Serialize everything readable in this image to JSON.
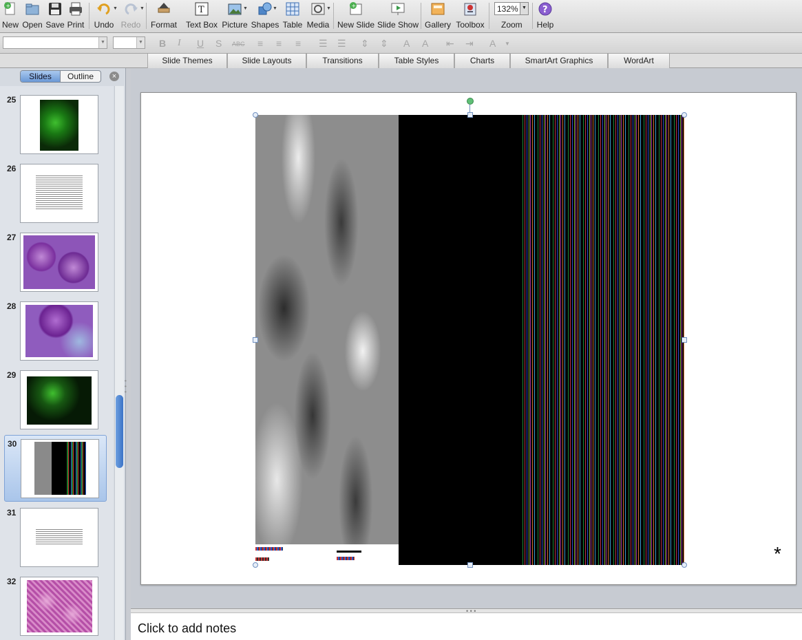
{
  "toolbar": {
    "new": "New",
    "open": "Open",
    "save": "Save",
    "print": "Print",
    "undo": "Undo",
    "redo": "Redo",
    "format": "Format",
    "text_box": "Text Box",
    "picture": "Picture",
    "shapes": "Shapes",
    "table": "Table",
    "media": "Media",
    "new_slide": "New Slide",
    "slide_show": "Slide Show",
    "gallery": "Gallery",
    "toolbox": "Toolbox",
    "zoom_label": "Zoom",
    "zoom_value": "132%",
    "help": "Help"
  },
  "ribbon": {
    "tabs": [
      "Slide Themes",
      "Slide Layouts",
      "Transitions",
      "Table Styles",
      "Charts",
      "SmartArt Graphics",
      "WordArt"
    ]
  },
  "sidebar": {
    "view_slides": "Slides",
    "view_outline": "Outline",
    "slides": [
      {
        "num": "25",
        "kind": "green-fluorescence"
      },
      {
        "num": "26",
        "kind": "text"
      },
      {
        "num": "27",
        "kind": "purple-histology"
      },
      {
        "num": "28",
        "kind": "purple-histology"
      },
      {
        "num": "29",
        "kind": "green-fluorescence"
      },
      {
        "num": "30",
        "kind": "micrograph-stripes",
        "selected": true
      },
      {
        "num": "31",
        "kind": "text"
      },
      {
        "num": "32",
        "kind": "pink-histology"
      }
    ]
  },
  "slide": {
    "asterisk": "*"
  },
  "notes": {
    "placeholder": "Click to add notes"
  },
  "colors": {
    "accent": "#3b73c7",
    "selection": "#a9c5ea",
    "rotate_handle": "#5fbf76"
  }
}
